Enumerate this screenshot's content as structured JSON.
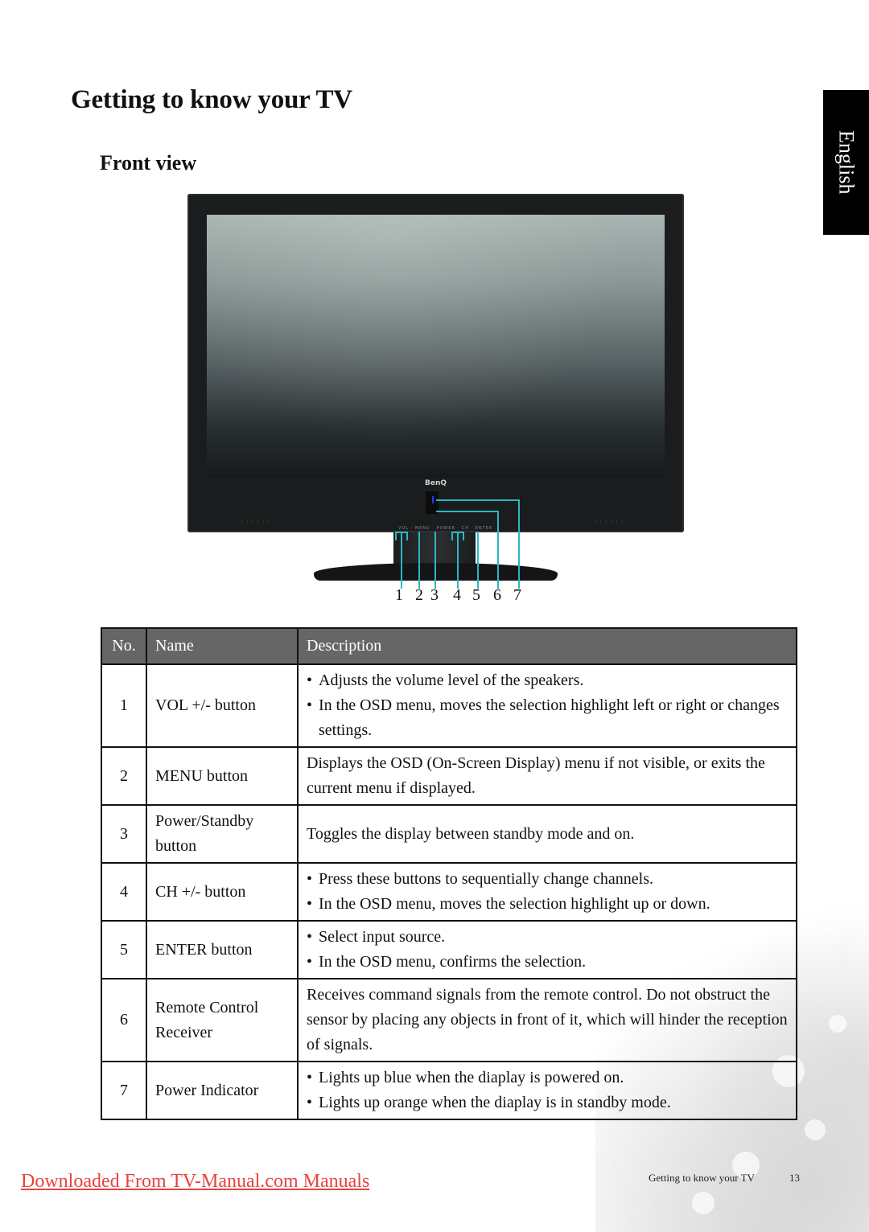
{
  "page": {
    "title": "Getting to know your TV",
    "section_title": "Front view",
    "language_tab": "English"
  },
  "illustration": {
    "brand_logo": "BenQ",
    "callout_numbers": [
      "1",
      "2",
      "3",
      "4",
      "5",
      "6",
      "7"
    ],
    "callout_color": "#2ab7c6",
    "led_color": "#2a33ff"
  },
  "table": {
    "headers": {
      "no": "No.",
      "name": "Name",
      "description": "Description"
    },
    "header_bg": "#666666",
    "rows": [
      {
        "no": "1",
        "name": "VOL +/- button",
        "type": "bullets",
        "description": [
          "Adjusts the volume level of the speakers.",
          "In the OSD menu, moves the selection highlight left or right or changes settings."
        ]
      },
      {
        "no": "2",
        "name": "MENU button",
        "type": "text",
        "description": "Displays the OSD (On-Screen Display) menu if not visible, or exits the current menu if displayed."
      },
      {
        "no": "3",
        "name": "Power/Standby button",
        "type": "text",
        "description": "Toggles the display between standby mode and on."
      },
      {
        "no": "4",
        "name": "CH +/- button",
        "type": "bullets",
        "description": [
          "Press these buttons to sequentially change channels.",
          "In the OSD menu, moves the selection highlight up or down."
        ]
      },
      {
        "no": "5",
        "name": "ENTER button",
        "type": "bullets",
        "description": [
          "Select input source.",
          "In the OSD menu, confirms the selection."
        ]
      },
      {
        "no": "6",
        "name": "Remote Control Receiver",
        "type": "text",
        "description": "Receives command signals from the remote control. Do not obstruct the sensor by placing any objects in front of it, which will hinder the reception of signals."
      },
      {
        "no": "7",
        "name": "Power Indicator",
        "type": "bullets",
        "description": [
          "Lights up blue when the diaplay is powered on.",
          "Lights up orange when the diaplay is in standby mode."
        ]
      }
    ]
  },
  "footer": {
    "download_link": "Downloaded From TV-Manual.com Manuals",
    "link_color": "#e8423f",
    "running_title": "Getting to know your TV",
    "page_number": "13"
  }
}
